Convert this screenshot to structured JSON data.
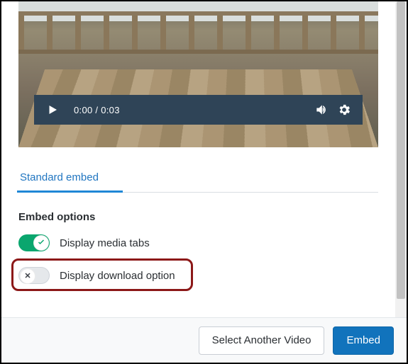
{
  "video": {
    "time_display": "0:00 / 0:03"
  },
  "tabs": {
    "standard": "Standard embed"
  },
  "options": {
    "heading": "Embed options",
    "display_media_tabs": {
      "label": "Display media tabs",
      "on": true
    },
    "display_download": {
      "label": "Display download option",
      "on": false
    }
  },
  "footer": {
    "select_another": "Select Another Video",
    "embed": "Embed"
  },
  "colors": {
    "accent": "#1173bc",
    "toggle_on": "#0aa66e",
    "highlight": "#8c1818"
  }
}
